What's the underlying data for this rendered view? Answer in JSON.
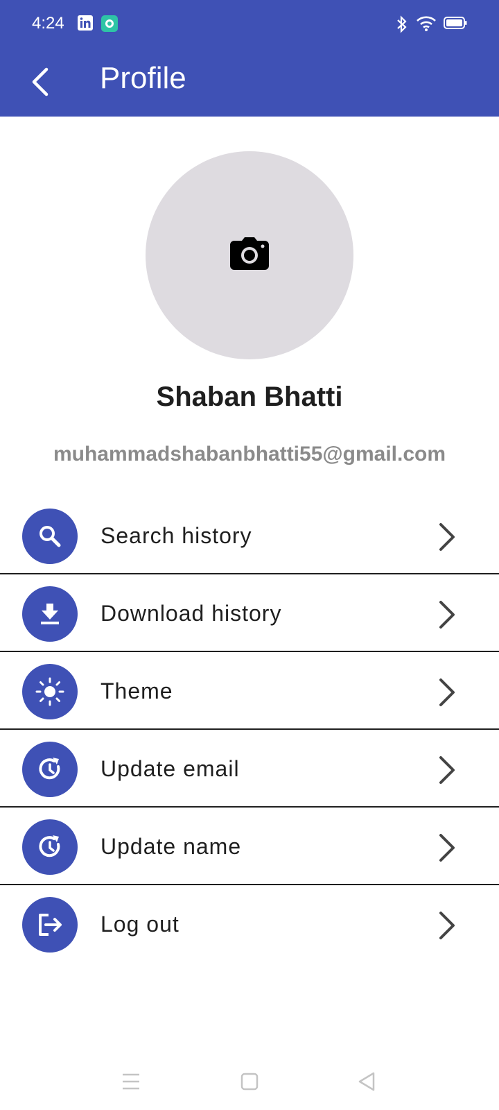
{
  "status_bar": {
    "time": "4:24",
    "left_icons": [
      "linkedin-icon",
      "app-notification-icon"
    ],
    "right_icons": [
      "bluetooth-icon",
      "wifi-icon",
      "battery-icon"
    ]
  },
  "header": {
    "title": "Profile",
    "back_icon": "back-arrow-icon"
  },
  "profile": {
    "avatar_icon": "camera-icon",
    "name": "Shaban Bhatti",
    "email": "muhammadshabanbhatti55@gmail.com"
  },
  "menu": {
    "items": [
      {
        "label": "Search history",
        "icon": "search-icon"
      },
      {
        "label": "Download history",
        "icon": "download-icon"
      },
      {
        "label": "Theme",
        "icon": "sun-icon"
      },
      {
        "label": "Update email",
        "icon": "update-icon"
      },
      {
        "label": "Update name",
        "icon": "update-icon"
      },
      {
        "label": "Log out",
        "icon": "logout-icon"
      }
    ]
  },
  "nav_bar": {
    "icons": [
      "menu-icon",
      "home-icon",
      "back-icon"
    ]
  },
  "colors": {
    "primary": "#3f51b5",
    "avatar_bg": "#dedbe0",
    "email_text": "#8a8a8a"
  }
}
